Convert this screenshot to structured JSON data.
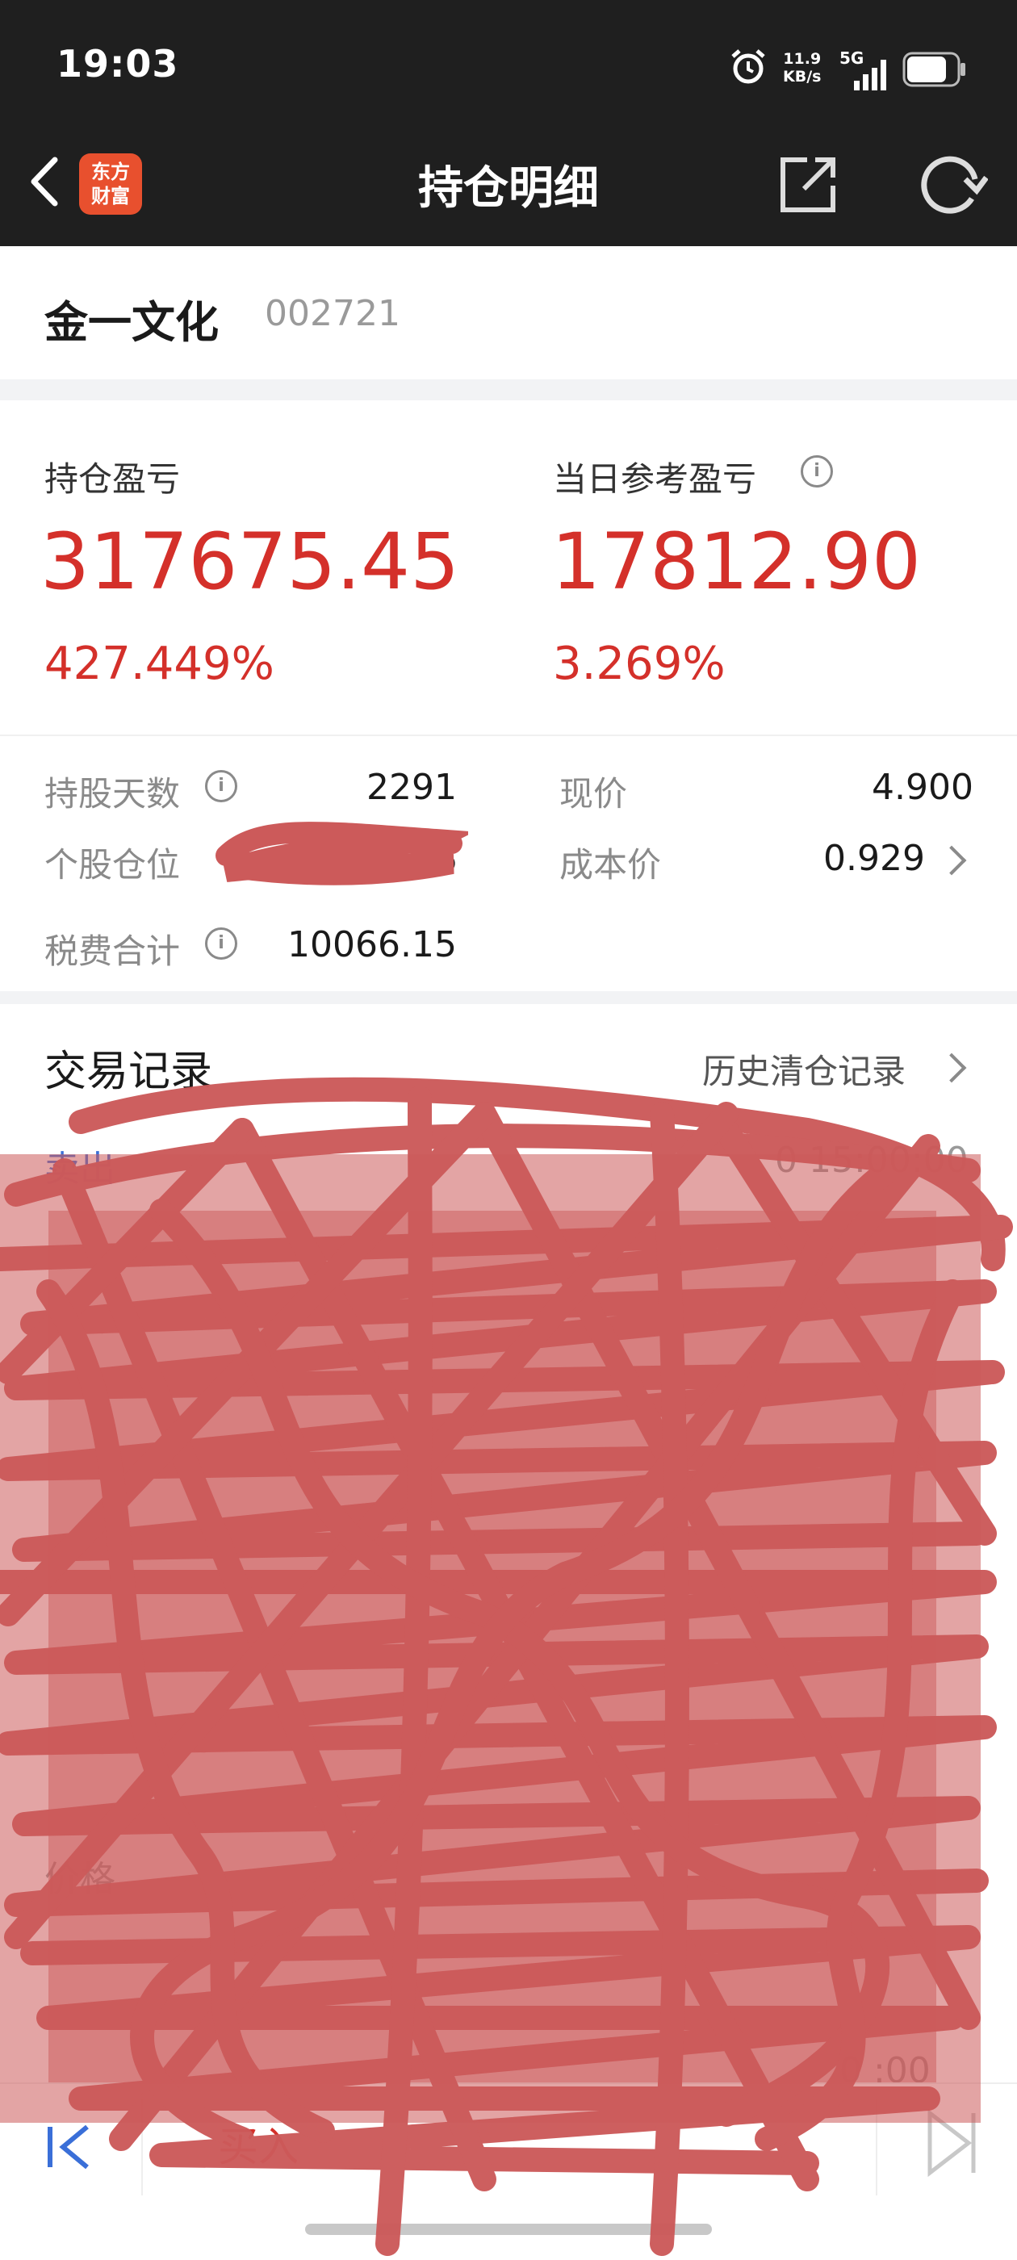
{
  "status_bar": {
    "time": "19:03",
    "net_rate_value": "11.9",
    "net_rate_unit": "KB/s",
    "network": "5G",
    "icons": [
      "alarm-icon",
      "signal-icon",
      "battery-icon"
    ]
  },
  "nav": {
    "title": "持仓明细",
    "logo_line1": "东方",
    "logo_line2": "财富",
    "icons": [
      "back-arrow-icon",
      "share-icon",
      "refresh-icon"
    ]
  },
  "stock": {
    "name": "金一文化",
    "code": "002721"
  },
  "summary": {
    "position_pnl_label": "持仓盈亏",
    "position_pnl_value": "317675.45",
    "position_pnl_pct": "427.449%",
    "daily_pnl_label": "当日参考盈亏",
    "daily_pnl_value": "17812.90",
    "daily_pnl_pct": "3.269%",
    "info_glyph": "i"
  },
  "details": {
    "hold_days_label": "持股天数",
    "hold_days_value": "2291",
    "position_ratio_label": "个股仓位",
    "position_ratio_value": "%",
    "fees_label": "税费合计",
    "fees_value": "10066.15",
    "current_price_label": "现价",
    "current_price_value": "4.900",
    "cost_price_label": "成本价",
    "cost_price_value": "0.929"
  },
  "trades": {
    "title": "交易记录",
    "history_link": "历史清仓记录",
    "first_type": "卖出",
    "first_time": "0 15:00:00",
    "price_label": "价格",
    "last_time": "0 :00"
  },
  "bottom_bar": {
    "buy_label": "买入"
  },
  "colors": {
    "profit_red": "#d4302a",
    "nav_bg": "#1f1f1f",
    "logo_orange": "#e8502e",
    "link_blue": "#3a6fd8",
    "scribble": "#cc5a5a"
  }
}
